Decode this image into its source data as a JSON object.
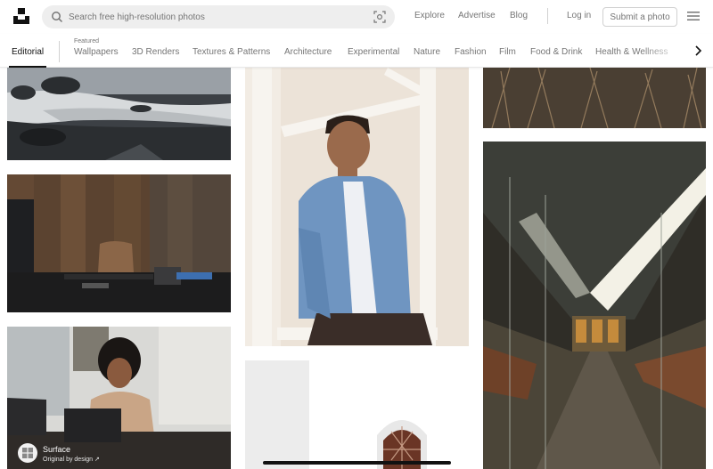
{
  "header": {
    "search_placeholder": "Search free high-resolution photos",
    "links": {
      "explore": "Explore",
      "advertise": "Advertise",
      "blog": "Blog",
      "login": "Log in"
    },
    "submit_label": "Submit a photo"
  },
  "nav": {
    "active": "Editorial",
    "featured_caption": "Featured",
    "items": [
      "Wallpapers",
      "3D Renders",
      "Textures & Patterns",
      "Architecture",
      "Experimental",
      "Nature",
      "Fashion",
      "Film",
      "Food & Drink",
      "Health & Wellness"
    ]
  },
  "attribution": {
    "name": "Surface",
    "subtitle": "Original by design ↗"
  },
  "colors": {
    "accent": "#111111",
    "muted": "#767676",
    "search_bg": "#eeeeee"
  },
  "icons": [
    "unsplash-logo-icon",
    "search-icon",
    "visual-search-icon",
    "hamburger-menu-icon",
    "chevron-right-icon",
    "surface-logo-icon"
  ]
}
